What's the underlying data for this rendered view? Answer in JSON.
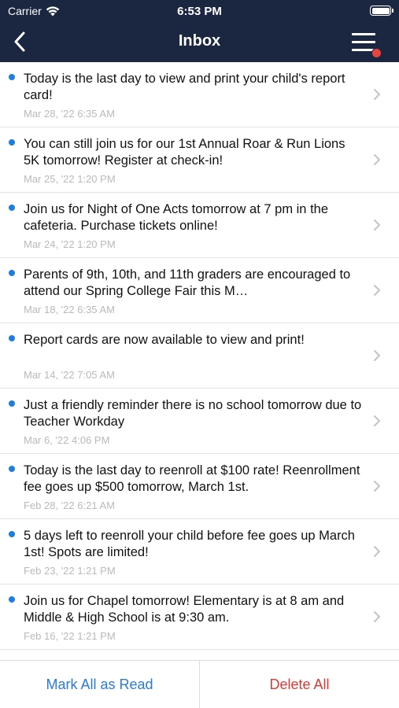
{
  "status_bar": {
    "carrier": "Carrier",
    "time": "6:53 PM"
  },
  "nav": {
    "title": "Inbox"
  },
  "messages": [
    {
      "text": "Today is the last day to view and print your child's report card!",
      "date": "Mar 28, '22 6:35 AM",
      "unread": true
    },
    {
      "text": "You can still join us for our 1st Annual Roar & Run Lions 5K tomorrow! Register at check-in!",
      "date": "Mar 25, '22 1:20 PM",
      "unread": true
    },
    {
      "text": "Join us for Night of One Acts tomorrow at 7 pm in the cafeteria. Purchase tickets online!",
      "date": "Mar 24, '22 1:20 PM",
      "unread": true
    },
    {
      "text": "Parents of 9th, 10th, and 11th graders are encouraged to attend our Spring College Fair this M…",
      "date": "Mar 18, '22 6:35 AM",
      "unread": true
    },
    {
      "text": "Report cards are now available to view and print!",
      "date": "Mar 14, '22 7:05 AM",
      "unread": true
    },
    {
      "text": "Just a friendly reminder there is no school tomorrow due to Teacher Workday",
      "date": "Mar 6, '22 4:06 PM",
      "unread": true
    },
    {
      "text": "Today is the last day to reenroll at $100 rate! Reenrollment fee goes up $500 tomorrow,  March 1st.",
      "date": "Feb 28, '22 6:21 AM",
      "unread": true
    },
    {
      "text": "5 days left to reenroll your child before fee goes up March 1st! Spots are limited!",
      "date": "Feb 23, '22 1:21 PM",
      "unread": true
    },
    {
      "text": "Join us for Chapel tomorrow! Elementary is at 8 am and Middle & High School is at 9:30 am.",
      "date": "Feb 16, '22 1:21 PM",
      "unread": true
    }
  ],
  "actions": {
    "mark_all_read": "Mark All as Read",
    "delete_all": "Delete All"
  },
  "colors": {
    "navbar": "#1b2640",
    "unread_dot": "#1e7ee0",
    "mark_all": "#2a7bd1",
    "delete_all": "#d93a33",
    "badge": "#e8433f"
  }
}
